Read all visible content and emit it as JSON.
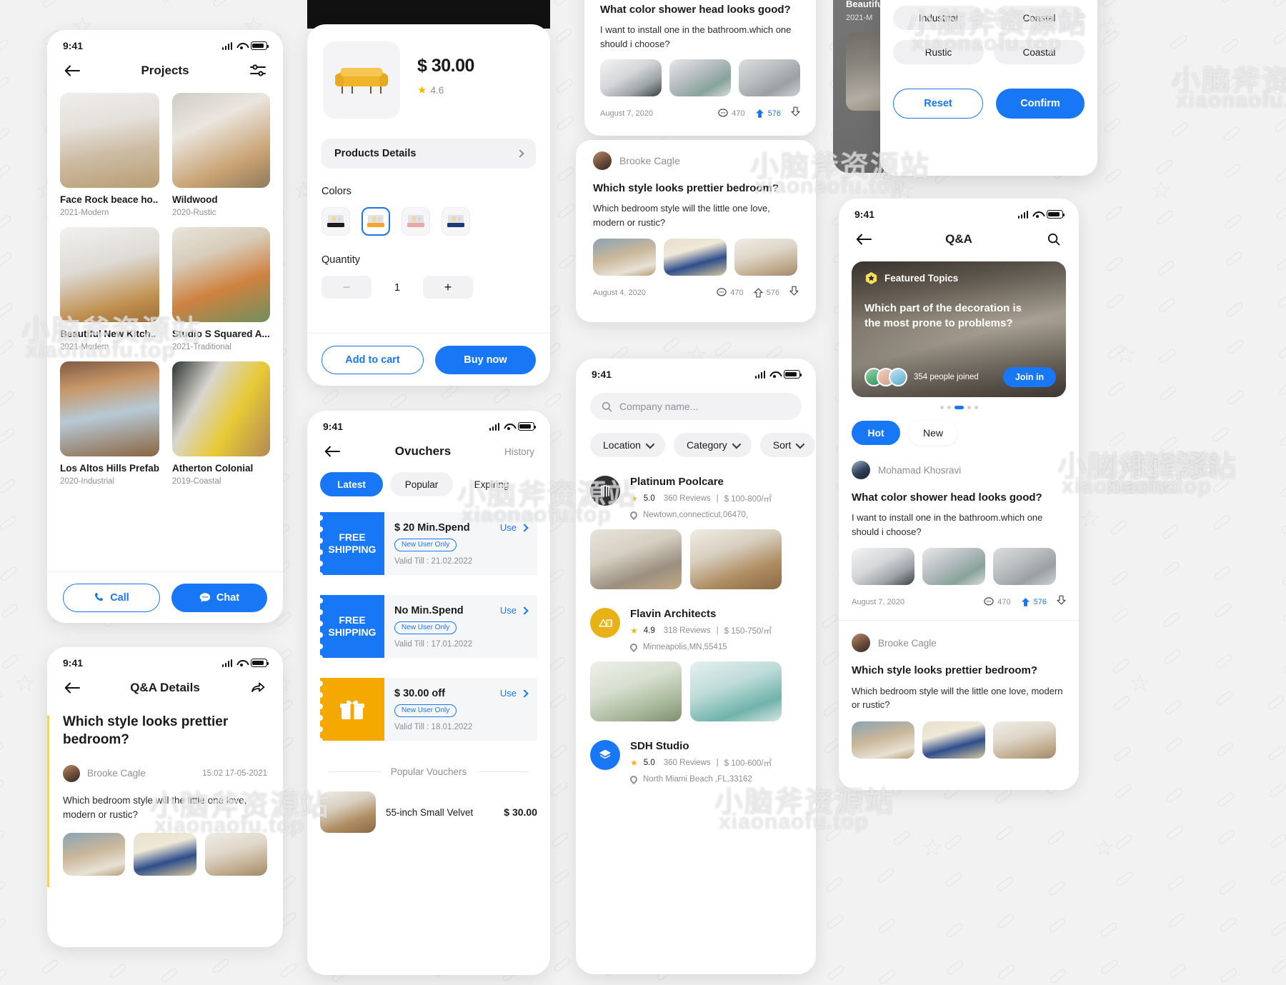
{
  "common": {
    "time": "9:41"
  },
  "projects": {
    "title": "Projects",
    "back_icon": "arrow-left-icon",
    "filter_icon": "sliders-icon",
    "items": [
      {
        "name": "Face Rock beace ho..",
        "meta": "2021-Modern",
        "thumb": "k1"
      },
      {
        "name": "Wildwood",
        "meta": "2020-Rustic",
        "thumb": "k2b"
      },
      {
        "name": "Beautiful New Kitch..",
        "meta": "2021-Modern",
        "thumb": "k3"
      },
      {
        "name": "Studio S Squared A...",
        "meta": "2021-Traditional",
        "thumb": "k4"
      },
      {
        "name": "Los Altos Hills Prefab",
        "meta": "2020-Industrial",
        "thumb": "k5"
      },
      {
        "name": "Atherton Colonial",
        "meta": "2019-Coastal",
        "thumb": "k6"
      }
    ],
    "call_label": "Call",
    "chat_label": "Chat"
  },
  "qa_details": {
    "title": "Q&A Details",
    "share_icon": "share-icon",
    "question": "Which style looks prettier bedroom?",
    "author": "Brooke Cagle",
    "timestamp": "15:02 17-05-2021",
    "body": "Which bedroom style will the little one love, modern or rustic?"
  },
  "product": {
    "price": "$ 30.00",
    "rating": "4.6",
    "details_label": "Products Details",
    "colors_label": "Colors",
    "colors": [
      {
        "name": "black",
        "selected": false,
        "swatch": "#1d1d1f"
      },
      {
        "name": "yellow",
        "selected": true,
        "swatch": "#f0a830"
      },
      {
        "name": "pink",
        "selected": false,
        "swatch": "#e8a8aa"
      },
      {
        "name": "navy",
        "selected": false,
        "swatch": "#1b3a78"
      }
    ],
    "quantity_label": "Quantity",
    "quantity": "1",
    "minus_label": "−",
    "plus_label": "+",
    "add_to_cart": "Add to cart",
    "buy_now": "Buy now"
  },
  "vouchers": {
    "title": "Ovuchers",
    "history_label": "History",
    "tabs": [
      {
        "label": "Latest",
        "active": true
      },
      {
        "label": "Popular",
        "active": false
      },
      {
        "label": "Expiring",
        "active": false
      }
    ],
    "items": [
      {
        "stamp_line1": "FREE",
        "stamp_line2": "SHIPPING",
        "stamp_color": "#1877f5",
        "stamp_icon": "",
        "title": "$ 20 Min.Spend",
        "badge": "New User Only",
        "valid": "Valid Till : 21.02.2022",
        "use": "Use"
      },
      {
        "stamp_line1": "FREE",
        "stamp_line2": "SHIPPING",
        "stamp_color": "#1877f5",
        "stamp_icon": "",
        "title": "No Min.Spend",
        "badge": "New User Only",
        "valid": "Valid Till : 17.01.2022",
        "use": "Use"
      },
      {
        "stamp_line1": "",
        "stamp_line2": "",
        "stamp_color": "#f5a800",
        "stamp_icon": "gift-icon",
        "title": "$ 30.00 off",
        "badge": "New User Only",
        "valid": "Valid Till : 18.01.2022",
        "use": "Use"
      }
    ],
    "popular_label": "Popular Vouchers",
    "popular_item": {
      "title": "55-inch Small Velvet",
      "price": "$ 30.00"
    }
  },
  "qa_feed": {
    "post1": {
      "question": "What color shower head looks good?",
      "body": "I want to install one in the bathroom.which one should i choose?",
      "date": "August 7, 2020",
      "comments": "470",
      "upvotes": "576",
      "thumbs": [
        "sh1",
        "sh2",
        "sh3"
      ]
    },
    "post2": {
      "author": "Brooke Cagle",
      "question": "Which style looks prettier bedroom?",
      "body": "Which bedroom style will the little one love, modern or rustic?",
      "date": "August 4, 2020",
      "comments": "470",
      "upvotes": "576",
      "thumbs": [
        "bd1",
        "bd2",
        "bd3"
      ]
    }
  },
  "companies": {
    "search_placeholder": "Company name...",
    "search_icon": "search-icon",
    "filters": [
      {
        "label": "Location"
      },
      {
        "label": "Category"
      },
      {
        "label": "Sort"
      }
    ],
    "items": [
      {
        "name": "Platinum Poolcare",
        "rating": "5.0",
        "reviews": "360 Reviews",
        "price": "$ 100-800/㎡",
        "address": "Newtown,connecticut,06470,",
        "logo_bg": "#2f3033",
        "logo_fg": "#ffffff",
        "logo_icon": "columns-icon",
        "photos": [
          "liv1",
          "liv2"
        ]
      },
      {
        "name": "Flavin Architects",
        "rating": "4.9",
        "reviews": "318 Reviews",
        "price": "$ 150-750/㎡",
        "address": "Minneapolis,MN,55415",
        "logo_bg": "#e8b217",
        "logo_fg": "#ffffff",
        "logo_icon": "house-icon",
        "photos": [
          "liv3",
          "liv4"
        ]
      },
      {
        "name": "SDH Studio",
        "rating": "5.0",
        "reviews": "360 Reviews",
        "price": "$ 100-600/㎡",
        "address": "North Miami Beach ,FL,33162",
        "logo_bg": "#1877f5",
        "logo_fg": "#ffffff",
        "logo_icon": "layers-icon",
        "photos": []
      }
    ]
  },
  "filter_modal": {
    "styles": [
      {
        "label": "Industrial",
        "selected": false
      },
      {
        "label": "Coastal",
        "selected": false
      },
      {
        "label": "Rustic",
        "selected": false
      },
      {
        "label": "Coastal",
        "selected": false
      }
    ],
    "reset_label": "Reset",
    "confirm_label": "Confirm",
    "behind_item": {
      "name": "Beautiful",
      "meta": "2021-M"
    }
  },
  "qa_home": {
    "title": "Q&A",
    "search_icon": "search-icon",
    "featured": {
      "badge": "Featured Topics",
      "badge_icon": "star-badge-icon",
      "headline": "Which part of the decoration is the most prone to problems?",
      "joined": "354 people joined",
      "join_label": "Join in",
      "dots": 5,
      "active_dot": 2
    },
    "tabs": [
      {
        "label": "Hot",
        "active": true
      },
      {
        "label": "New",
        "active": false
      }
    ],
    "post1": {
      "author": "Mohamad Khosravi",
      "question": "What color shower head looks good?",
      "body": "I want to install one in the bathroom.which one should i choose?",
      "date": "August 7, 2020",
      "comments": "470",
      "upvotes": "576",
      "thumbs": [
        "sh1",
        "sh2",
        "sh3"
      ]
    },
    "post2": {
      "author": "Brooke Cagle",
      "question": "Which style looks prettier bedroom?",
      "body": "Which bedroom style will the little one love, modern or rustic?",
      "thumbs": [
        "bd1",
        "bd2",
        "bd3"
      ]
    }
  },
  "colors": {
    "accent": "#1877f5",
    "gold": "#f5b800",
    "orange": "#f5a800",
    "muted": "#8e8e93",
    "surface": "#f2f2f2"
  },
  "watermark": {
    "cn": "小脑斧资源站",
    "en": "xiaonaofu.top"
  }
}
